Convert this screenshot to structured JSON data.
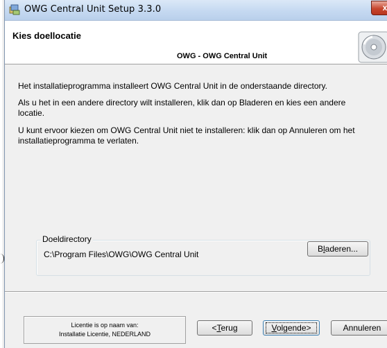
{
  "window": {
    "title": "OWG Central Unit Setup 3.3.0",
    "close_label": "x"
  },
  "header": {
    "title": "Kies doellocatie",
    "subtitle": "OWG - OWG Central Unit",
    "icon": "cd-install-icon"
  },
  "body": {
    "paragraphs": [
      "Het installatieprogramma installeert OWG Central Unit in de onderstaande directory.",
      "Als u het in een andere directory wilt installeren, klik dan op Bladeren en kies een andere locatie.",
      "U kunt ervoor kiezen om OWG Central Unit niet te installeren: klik dan op Annuleren om het installatieprogramma te verlaten."
    ]
  },
  "destination": {
    "legend": "Doeldirectory",
    "path": "C:\\Program Files\\OWG\\OWG Central Unit",
    "browse_label_pre": "B",
    "browse_label_u": "l",
    "browse_label_post": "aderen..."
  },
  "license": {
    "line1": "Licentie is op naam van:",
    "line2": "Installatie Licentie,  NEDERLAND"
  },
  "footer": {
    "back_pre": "<",
    "back_u": "T",
    "back_post": "erug",
    "next_u": "V",
    "next_post": "olgende>",
    "cancel_label": "Annuleren"
  }
}
